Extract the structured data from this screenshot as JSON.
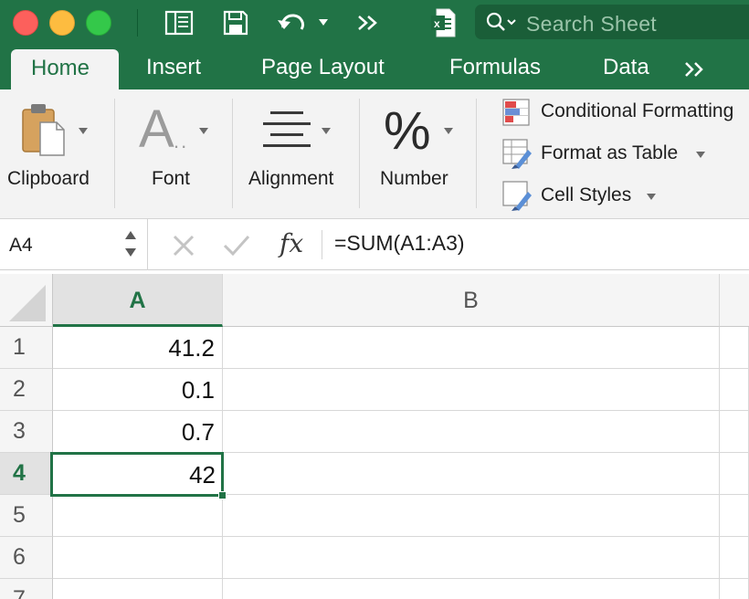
{
  "titlebar": {
    "search_placeholder": "Search Sheet",
    "icons": [
      "sidebar-icon",
      "save-icon",
      "undo-icon",
      "more-icon",
      "excel-file-icon",
      "search-icon"
    ]
  },
  "ribbon_tabs": {
    "home": "Home",
    "insert": "Insert",
    "page_layout": "Page Layout",
    "formulas": "Formulas",
    "data": "Data"
  },
  "ribbon": {
    "clipboard": "Clipboard",
    "font": "Font",
    "alignment": "Alignment",
    "number": "Number",
    "number_glyph": "%",
    "font_glyph": "A",
    "styles": {
      "conditional_formatting": "Conditional Formatting",
      "format_as_table": "Format as Table",
      "cell_styles": "Cell Styles"
    }
  },
  "formula_bar": {
    "name_box": "A4",
    "fx": "fx",
    "formula": "=SUM(A1:A3)"
  },
  "grid": {
    "columns": [
      "A",
      "B"
    ],
    "selected_column": "A",
    "rows": [
      {
        "num": "1",
        "a": "41.2"
      },
      {
        "num": "2",
        "a": "0.1"
      },
      {
        "num": "3",
        "a": "0.7"
      },
      {
        "num": "4",
        "a": "42"
      },
      {
        "num": "5",
        "a": ""
      },
      {
        "num": "6",
        "a": ""
      },
      {
        "num": "7",
        "a": ""
      }
    ],
    "active_cell": "A4"
  },
  "colors": {
    "accent": "#217346",
    "ribbon_bg": "#f3f3f3"
  }
}
